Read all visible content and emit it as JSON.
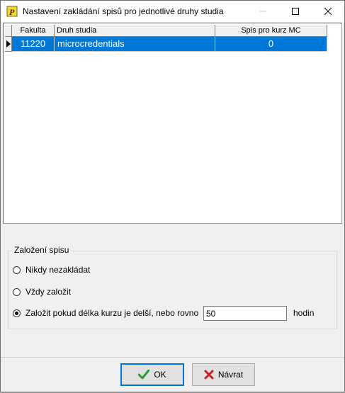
{
  "window": {
    "title": "Nastavení zakládání spisů pro jednotlivé druhy studia"
  },
  "grid": {
    "columns": [
      "Fakulta",
      "Druh studia",
      "Spis pro kurz MC"
    ],
    "rows": [
      {
        "fakulta": "11220",
        "druh_studia": "microcredentials",
        "spis": "0"
      }
    ]
  },
  "group": {
    "title": "Založení spisu",
    "options": [
      {
        "label": "Nikdy nezakládat",
        "checked": false
      },
      {
        "label": "Vždy založit",
        "checked": false
      },
      {
        "label": "Založit pokud délka kurzu je delší, nebo rovno",
        "checked": true
      }
    ],
    "hours_value": "50",
    "hours_unit": "hodin"
  },
  "buttons": {
    "ok_label": "OK",
    "back_label": "Návrat"
  },
  "colors": {
    "selection": "#0078d7",
    "ok_icon": "#2e9e2e",
    "back_icon": "#c81e1e"
  }
}
